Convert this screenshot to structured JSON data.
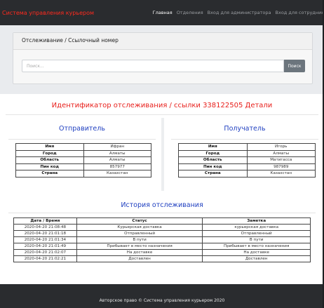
{
  "navbar": {
    "brand": "Система управления курьером",
    "links": [
      {
        "label": "Главная",
        "active": true
      },
      {
        "label": "Отделения",
        "active": false
      },
      {
        "label": "Вход для администратора",
        "active": false
      },
      {
        "label": "Вход для сотрудников",
        "active": false
      }
    ]
  },
  "tracking": {
    "header": "Отслеживание / Ссылочный номер",
    "input_placeholder": "Поиск...",
    "search_label": "Поиск"
  },
  "result": {
    "title": "Идентификатор отслеживания / ссылки 338122505 Детали"
  },
  "sender": {
    "title": "Отправитель",
    "rows": [
      {
        "key": "Имя",
        "value": "Ифран"
      },
      {
        "key": "Город",
        "value": "Алматы"
      },
      {
        "key": "Область",
        "value": "Алматы"
      },
      {
        "key": "Пин код",
        "value": "857977"
      },
      {
        "key": "Страна",
        "value": "Казахстан"
      }
    ]
  },
  "receiver": {
    "title": "Получатель",
    "rows": [
      {
        "key": "Имя",
        "value": "Игорь"
      },
      {
        "key": "Город",
        "value": "Алматы"
      },
      {
        "key": "Область",
        "value": "Матигасса"
      },
      {
        "key": "Пин код",
        "value": "987989"
      },
      {
        "key": "Страна",
        "value": "Казахстан"
      }
    ]
  },
  "history": {
    "title": "История отслеживания",
    "columns": [
      "Дата / Время",
      "Статус",
      "Заметка"
    ],
    "rows": [
      [
        "2020-04-20 21:08:48",
        "Курьерская доставка",
        "курьерская доставка"
      ],
      [
        "2020-04-20 21:01:18",
        "Отправленный",
        "Отправленный"
      ],
      [
        "2020-04-20 21:01:34",
        "В пути",
        "В пути"
      ],
      [
        "2020-04-20 21:01:49",
        "Прибывает в место назначения",
        "Прибывает в место назначения"
      ],
      [
        "2020-04-20 21:02:07",
        "На доставке",
        "На доставке"
      ],
      [
        "2020-04-20 21:02:21",
        "Доставлен",
        "Доставлен"
      ]
    ]
  },
  "footer": {
    "text": "Авторское право © Система управления курьером 2020"
  },
  "colors": {
    "navbar_bg": "#2a2c2f",
    "brand": "#ff2a1e",
    "result_title": "#e8201c",
    "section_title": "#1f3fc0",
    "search_button": "#6c757d"
  }
}
